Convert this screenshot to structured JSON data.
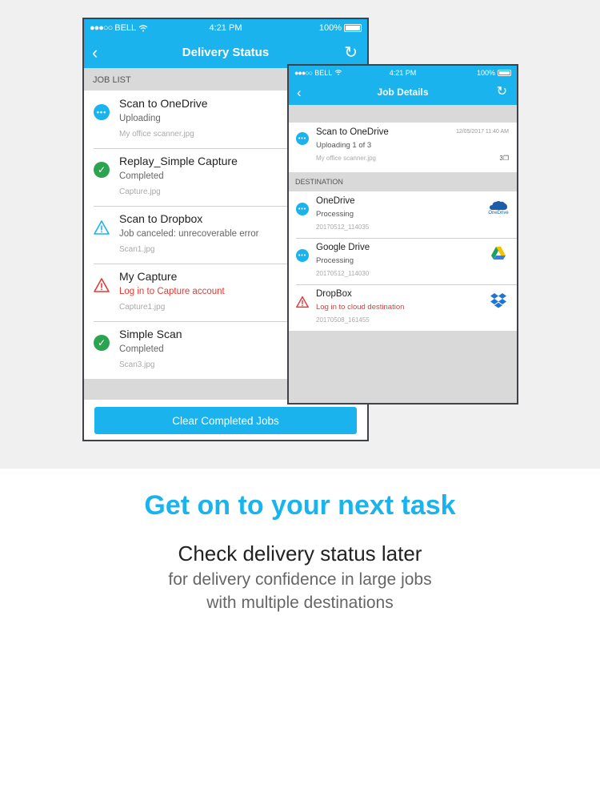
{
  "colors": {
    "accent": "#1ab3ee",
    "success": "#2aa44e",
    "error": "#e53935"
  },
  "phone1": {
    "status": {
      "carrier": "BELL",
      "time": "4:21 PM",
      "battery": "100%"
    },
    "nav": {
      "title": "Delivery Status",
      "back_icon": "chevron-left-icon",
      "refresh_icon": "refresh-icon"
    },
    "section_label": "JOB LIST",
    "jobs": [
      {
        "title": "Scan to OneDrive",
        "status": "Uploading",
        "file": "My office scanner.jpg",
        "icon": "in-progress-icon"
      },
      {
        "title": "Replay_Simple Capture",
        "status": "Completed",
        "file": "Capture.jpg",
        "icon": "check-icon"
      },
      {
        "title": "Scan to Dropbox",
        "status": "Job canceled: unrecoverable error",
        "file": "Scan1.jpg",
        "icon": "warning-icon"
      },
      {
        "title": "My Capture",
        "status": "Log in to Capture account",
        "file": "Capture1.jpg",
        "icon": "error-icon"
      },
      {
        "title": "Simple Scan",
        "status": "Completed",
        "file": "Scan3.jpg",
        "icon": "check-icon"
      }
    ],
    "clear_button": "Clear Completed Jobs"
  },
  "phone2": {
    "status": {
      "carrier": "BELL",
      "time": "4:21 PM",
      "battery": "100%"
    },
    "nav": {
      "title": "Job Details",
      "back_icon": "chevron-left-icon",
      "refresh_icon": "refresh-icon"
    },
    "job": {
      "title": "Scan to OneDrive",
      "status": "Uploading 1 of 3",
      "file": "My office scanner.jpg",
      "timestamp": "12/05/2017 11:40 AM",
      "page_count": "3"
    },
    "section_label": "DESTINATION",
    "destinations": [
      {
        "name": "OneDrive",
        "status": "Processing",
        "id": "20170512_114035",
        "logo": "onedrive-logo",
        "logo_text": "OneDrive"
      },
      {
        "name": "Google Drive",
        "status": "Processing",
        "id": "20170512_114030",
        "logo": "google-drive-logo"
      },
      {
        "name": "DropBox",
        "status": "Log in to cloud destination",
        "id": "20170508_161455",
        "logo": "dropbox-logo"
      }
    ]
  },
  "headline": "Get on to your next task",
  "subheadline": "Check delivery status later",
  "description_line1": "for delivery confidence in large jobs",
  "description_line2": "with multiple destinations"
}
